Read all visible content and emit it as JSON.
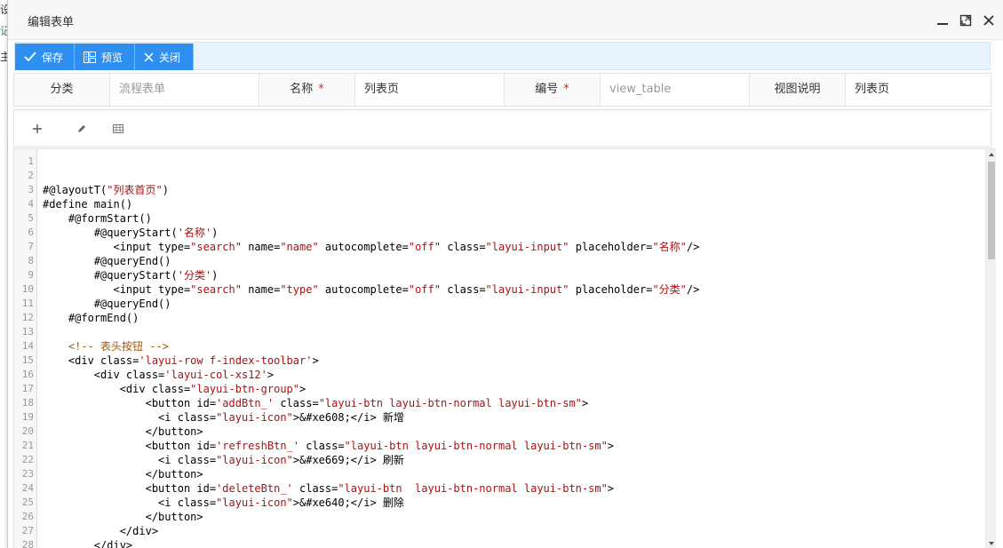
{
  "background": {
    "texts": [
      "设",
      "记",
      "主义"
    ]
  },
  "dialog": {
    "title": "编辑表单",
    "buttons": {
      "minimize": "minimize-icon",
      "maximize": "maximize-icon",
      "close": "close-icon"
    }
  },
  "toolbar": {
    "save": "保存",
    "preview": "预览",
    "close": "关闭"
  },
  "form": {
    "category_label": "分类",
    "category_placeholder": "流程表单",
    "name_label": "名称",
    "name_value": "列表页",
    "code_label": "编号",
    "code_placeholder": "view_table",
    "desc_label": "视图说明",
    "desc_value": "列表页",
    "required_mark": "*"
  },
  "editor_toolbar": {
    "add": "plus-icon",
    "edit": "pencil-icon",
    "table": "table-icon"
  },
  "code_lines": [
    "",
    "",
    "#@layoutT(\"列表首页\")",
    "#define main()",
    "    #@formStart()",
    "        #@queryStart('名称')",
    "           <input type=\"search\" name=\"name\" autocomplete=\"off\" class=\"layui-input\" placeholder=\"名称\"/>",
    "        #@queryEnd()",
    "        #@queryStart('分类')",
    "           <input type=\"search\" name=\"type\" autocomplete=\"off\" class=\"layui-input\" placeholder=\"分类\"/>",
    "        #@queryEnd()",
    "    #@formEnd()",
    "",
    "    <!-- 表头按钮 -->",
    "    <div class='layui-row f-index-toolbar'>",
    "        <div class='layui-col-xs12'>",
    "            <div class=\"layui-btn-group\">",
    "                <button id='addBtn_' class=\"layui-btn layui-btn-normal layui-btn-sm\">",
    "                  <i class=\"layui-icon\">&#xe608;</i> 新增",
    "                </button>",
    "                <button id='refreshBtn_' class=\"layui-btn layui-btn-normal layui-btn-sm\">",
    "                  <i class=\"layui-icon\">&#xe669;</i> 刷新",
    "                </button>",
    "                <button id='deleteBtn_' class=\"layui-btn  layui-btn-normal layui-btn-sm\">",
    "                  <i class=\"layui-icon\">&#xe640;</i> 删除",
    "                </button>",
    "            </div>",
    "        </div>"
  ]
}
